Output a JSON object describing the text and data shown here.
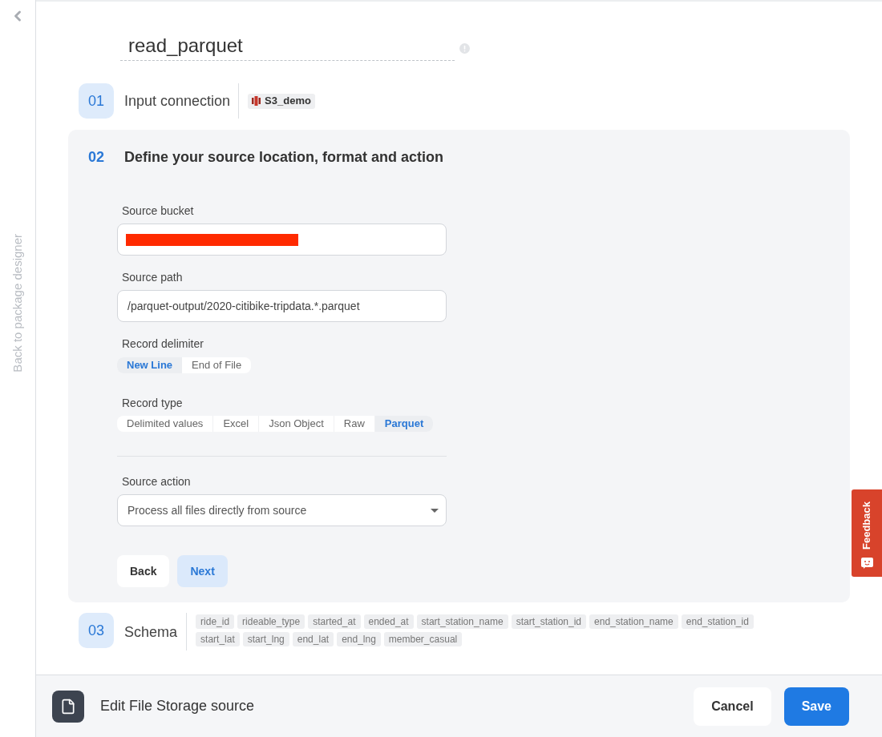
{
  "sidebar": {
    "back_label": "Back to package designer"
  },
  "title": {
    "value": "read_parquet"
  },
  "input_connection_step": {
    "number": "01",
    "title": "Input connection",
    "connection": "S3_demo"
  },
  "source_step": {
    "number": "02",
    "title": "Define your source location, format and action",
    "source_bucket": {
      "label": "Source bucket",
      "redacted": true
    },
    "source_path": {
      "label": "Source path",
      "value": "/parquet-output/2020-citibike-tripdata.*.parquet"
    },
    "record_delimiter": {
      "label": "Record delimiter",
      "options": [
        {
          "label": "New Line",
          "selected": true
        },
        {
          "label": "End of File",
          "selected": false
        }
      ]
    },
    "record_type": {
      "label": "Record type",
      "options": [
        {
          "label": "Delimited values",
          "selected": false
        },
        {
          "label": "Excel",
          "selected": false
        },
        {
          "label": "Json Object",
          "selected": false
        },
        {
          "label": "Raw",
          "selected": false
        },
        {
          "label": "Parquet",
          "selected": true
        }
      ]
    },
    "source_action": {
      "label": "Source action",
      "value": "Process all files directly from source"
    },
    "buttons": [
      {
        "label": "Back",
        "kind": "plain"
      },
      {
        "label": "Next",
        "kind": "accent"
      }
    ]
  },
  "schema_step": {
    "number": "03",
    "title": "Schema",
    "fields": [
      "ride_id",
      "rideable_type",
      "started_at",
      "ended_at",
      "start_station_name",
      "start_station_id",
      "end_station_name",
      "end_station_id",
      "start_lat",
      "start_lng",
      "end_lat",
      "end_lng",
      "member_casual"
    ]
  },
  "feedback": {
    "label": "Feedback"
  },
  "footer": {
    "title": "Edit File Storage source",
    "buttons": [
      {
        "label": "Cancel",
        "kind": "plain"
      },
      {
        "label": "Save",
        "kind": "primary"
      }
    ]
  }
}
